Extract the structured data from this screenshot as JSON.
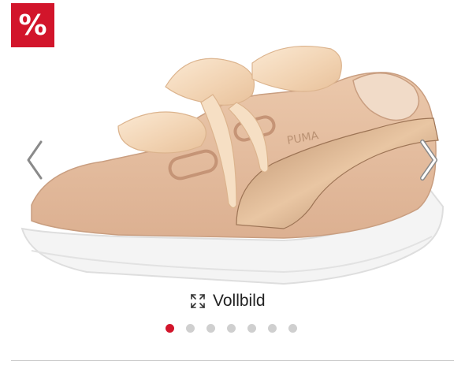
{
  "badge": {
    "text": "%",
    "color": "#d2152b"
  },
  "gallery": {
    "image_icon": "sneaker-image",
    "prev_icon": "chevron-left-icon",
    "next_icon": "chevron-right-icon",
    "fullscreen_label": "Vollbild",
    "fullscreen_icon": "expand-icon",
    "dots": 7,
    "active_dot": 1,
    "active_color": "#d2152b",
    "inactive_color": "#cfcfcf"
  }
}
